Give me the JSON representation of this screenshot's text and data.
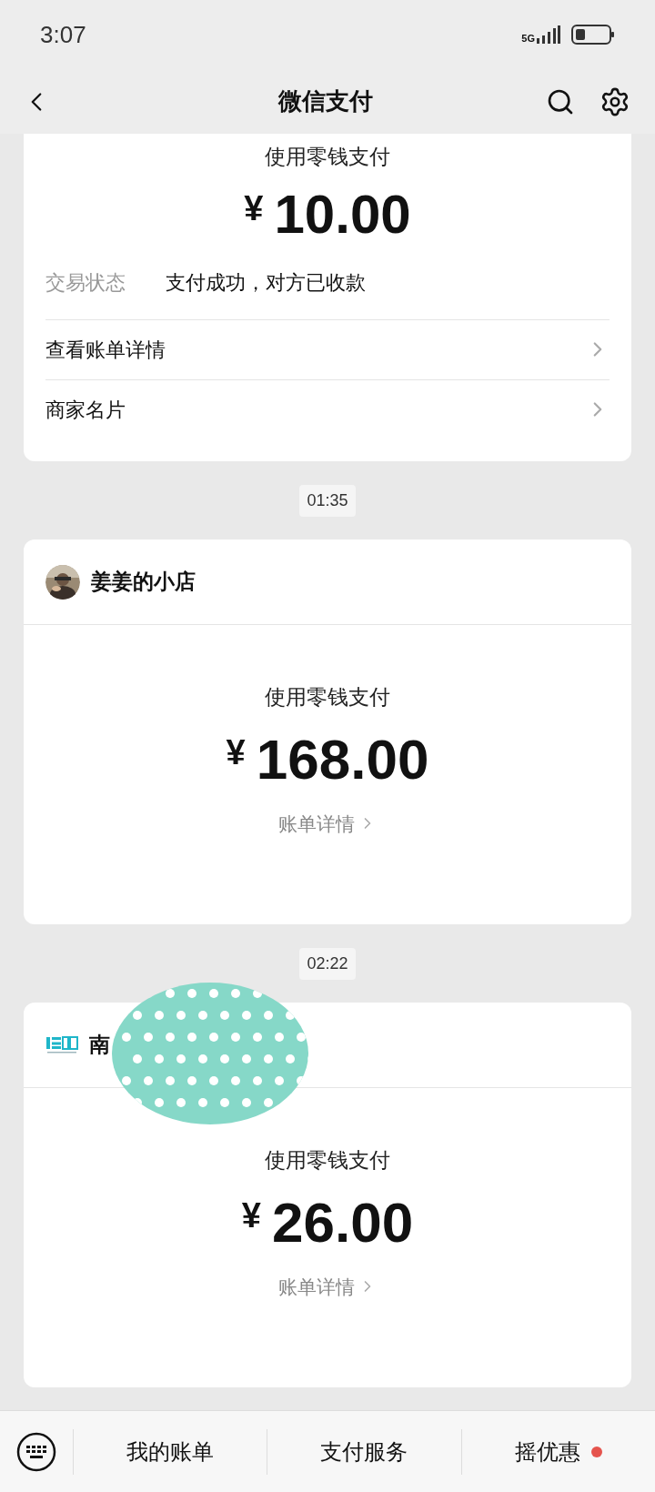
{
  "status_bar": {
    "time": "3:07",
    "network": "5G"
  },
  "nav": {
    "title": "微信支付"
  },
  "first_card": {
    "method": "使用零钱支付",
    "amount": "10.00",
    "currency": "¥",
    "status_label": "交易状态",
    "status_value": "支付成功，对方已收款",
    "links": [
      "查看账单详情",
      "商家名片"
    ]
  },
  "messages": [
    {
      "time": "01:35",
      "merchant": "姜姜的小店",
      "redacted": false,
      "method": "使用零钱支付",
      "currency": "¥",
      "amount": "168.00",
      "detail_link": "账单详情"
    },
    {
      "time": "02:22",
      "merchant": "南",
      "avatar": {
        "kind": "logo"
      },
      "redacted": true,
      "method": "使用零钱支付",
      "currency": "¥",
      "amount": "26.00",
      "detail_link": "账单详情"
    }
  ],
  "bottom_menu": [
    {
      "label": "我的账单",
      "badge": false
    },
    {
      "label": "支付服务",
      "badge": false
    },
    {
      "label": "摇优惠",
      "badge": true
    }
  ]
}
